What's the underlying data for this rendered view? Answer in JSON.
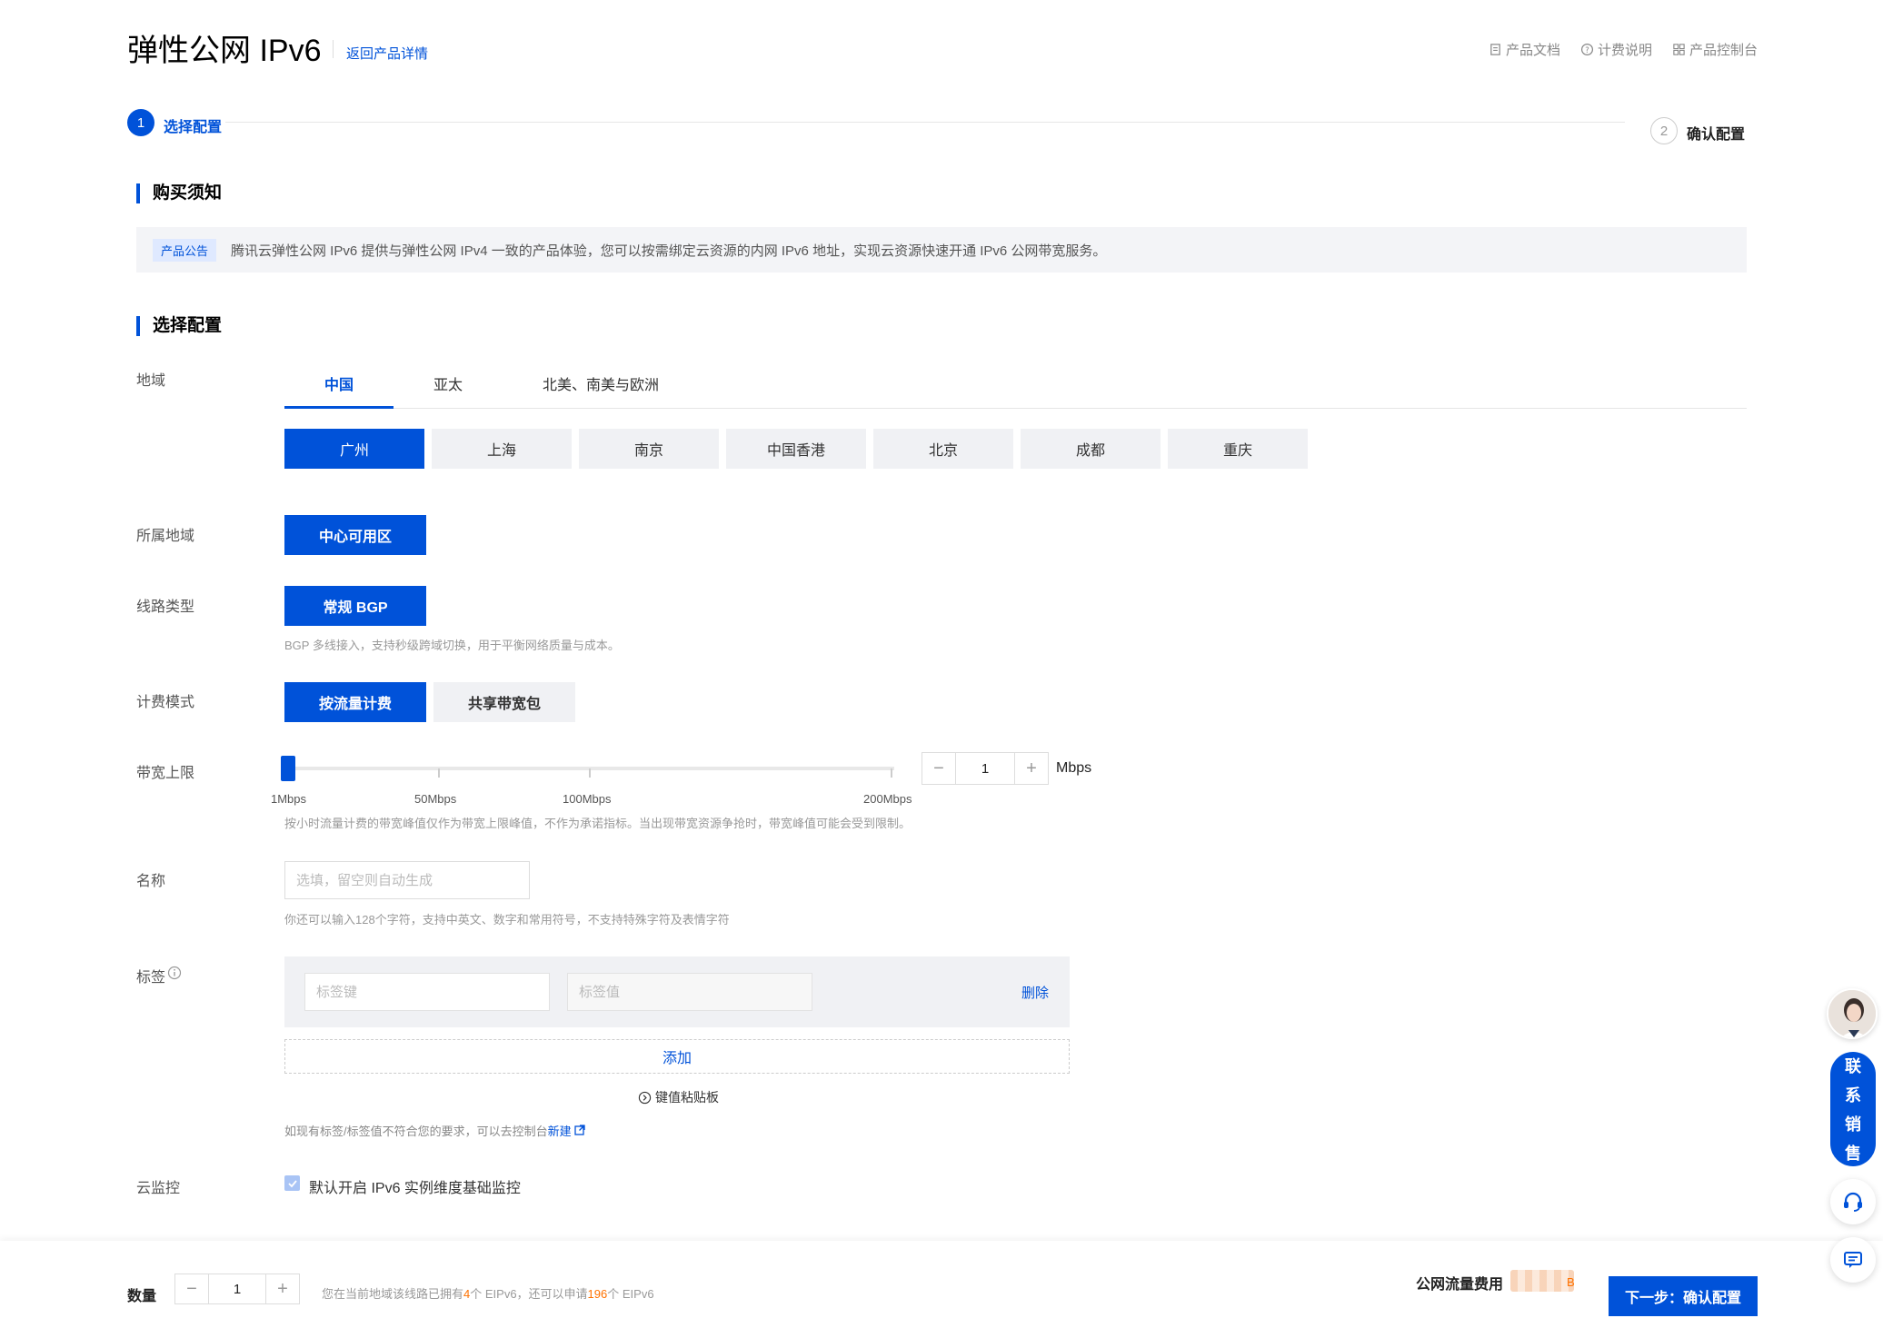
{
  "header": {
    "title": "弹性公网 IPv6",
    "back_link": "返回产品详情",
    "links": [
      "产品文档",
      "计费说明",
      "产品控制台"
    ]
  },
  "steps": [
    {
      "num": "1",
      "label": "选择配置"
    },
    {
      "num": "2",
      "label": "确认配置"
    }
  ],
  "notice": {
    "heading": "购买须知",
    "badge": "产品公告",
    "text": "腾讯云弹性公网 IPv6 提供与弹性公网 IPv4 一致的产品体验，您可以按需绑定云资源的内网 IPv6 地址，实现云资源快速开通 IPv6 公网带宽服务。"
  },
  "config": {
    "heading": "选择配置",
    "region_label": "地域",
    "region_tabs": [
      "中国",
      "亚太",
      "北美、南美与欧洲"
    ],
    "cities": [
      "广州",
      "上海",
      "南京",
      "中国香港",
      "北京",
      "成都",
      "重庆"
    ],
    "zone_label": "所属地域",
    "zone_option": "中心可用区",
    "line_label": "线路类型",
    "line_option": "常规 BGP",
    "line_hint": "BGP 多线接入，支持秒级跨域切换，用于平衡网络质量与成本。",
    "billing_label": "计费模式",
    "billing_options": [
      "按流量计费",
      "共享带宽包"
    ],
    "bandwidth_label": "带宽上限",
    "bandwidth_scale": [
      "1Mbps",
      "50Mbps",
      "100Mbps",
      "200Mbps"
    ],
    "bandwidth_value": "1",
    "bandwidth_level": 0,
    "bandwidth_unit": "Mbps",
    "bandwidth_hint": "按小时流量计费的带宽峰值仅作为带宽上限峰值，不作为承诺指标。当出现带宽资源争抢时，带宽峰值可能会受到限制。",
    "name_label": "名称",
    "name_placeholder": "选填，留空则自动生成",
    "name_hint": "你还可以输入128个字符，支持中英文、数字和常用符号，不支持特殊字符及表情字符",
    "tag_label": "标签",
    "tag_key_placeholder": "标签键",
    "tag_value_placeholder": "标签值",
    "tag_delete": "删除",
    "tag_add": "添加",
    "tag_paste": "键值粘贴板",
    "tag_hint": "如现有标签/标签值不符合您的要求，可以去控制台",
    "tag_hint_link": "新建",
    "monitor_label": "云监控",
    "monitor_text": "默认开启 IPv6 实例维度基础监控"
  },
  "bottom": {
    "qty_label": "数量",
    "qty_value": "1",
    "qty_hint_a": "您在当前地域该线路已拥有",
    "qty_hint_owned": "4",
    "qty_hint_b": "个 EIPv6，还可以申请",
    "qty_hint_remaining": "196",
    "qty_hint_c": "个 EIPv6",
    "fee_label": "公网流量费用",
    "fee_suffix": "B",
    "next_button": "下一步：确认配置"
  },
  "float": {
    "sales_chars": [
      "联",
      "系",
      "销",
      "售"
    ]
  }
}
